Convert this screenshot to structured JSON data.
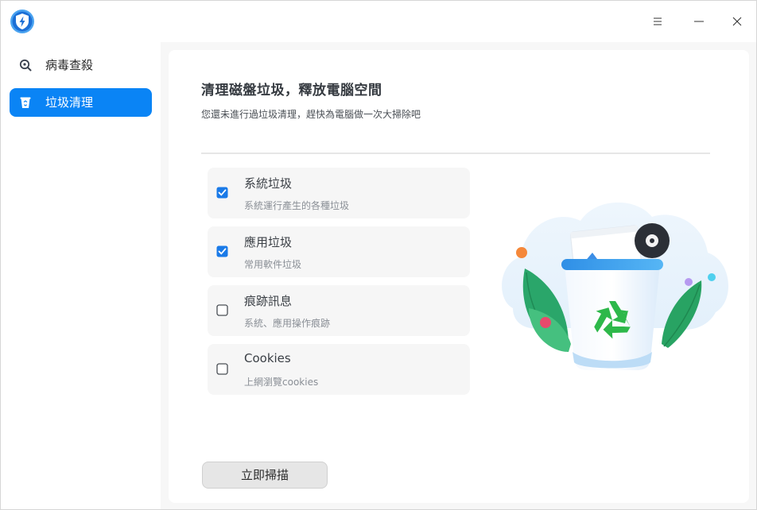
{
  "titlebar": {
    "logo_icon": "shield-bolt-icon",
    "menu_icon": "menu-icon",
    "minimize_icon": "minimize-icon",
    "close_icon": "close-icon"
  },
  "sidebar": {
    "items": [
      {
        "label": "病毒查殺",
        "icon": "virus-scan-icon",
        "active": false
      },
      {
        "label": "垃圾清理",
        "icon": "trash-icon",
        "active": true
      }
    ]
  },
  "main": {
    "title": "清理磁盤垃圾，釋放電腦空間",
    "subtitle": "您還未進行過垃圾清理，趕快為電腦做一次大掃除吧",
    "options": [
      {
        "title": "系統垃圾",
        "desc": "系統運行產生的各種垃圾",
        "checked": true
      },
      {
        "title": "應用垃圾",
        "desc": "常用軟件垃圾",
        "checked": true
      },
      {
        "title": "痕跡訊息",
        "desc": "系統、應用操作痕跡",
        "checked": false
      },
      {
        "title": "Cookies",
        "desc": "上網瀏覽cookies",
        "checked": false
      }
    ],
    "scan_button": "立即掃描"
  },
  "colors": {
    "accent": "#0a84f5",
    "checkbox_checked": "#1a7ae8",
    "recycle_green": "#2db84a"
  }
}
